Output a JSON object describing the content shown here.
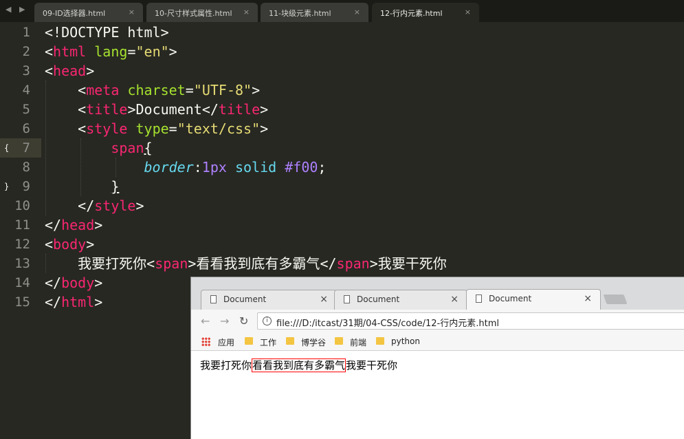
{
  "editor": {
    "tabs": [
      {
        "label": "09-ID选择器.html"
      },
      {
        "label": "10-尺寸样式属性.html"
      },
      {
        "label": "11-块级元素.html"
      },
      {
        "label": "12-行内元素.html"
      }
    ],
    "close_glyph": "×",
    "line_numbers": [
      "1",
      "2",
      "3",
      "4",
      "5",
      "6",
      "7",
      "8",
      "9",
      "10",
      "11",
      "12",
      "13",
      "14",
      "15"
    ],
    "code": {
      "l1": "<!DOCTYPE html>",
      "l2_open": "<",
      "l2_tag": "html",
      "l2_attr": "lang",
      "l2_eq": "=",
      "l2_val": "\"en\"",
      "l2_close": ">",
      "l3_tag": "head",
      "l4_tag": "meta",
      "l4_attr": "charset",
      "l4_val": "\"UTF-8\"",
      "l5_tag": "title",
      "l5_text": "Document",
      "l6_tag": "style",
      "l6_attr": "type",
      "l6_val": "\"text/css\"",
      "l7_sel": "span",
      "l7_brace": "{",
      "l8_prop": "border",
      "l8_num": "1px",
      "l8_kw": "solid",
      "l8_color": "#f00",
      "l8_semi": ";",
      "l9_brace": "}",
      "l10_tag": "style",
      "l11_tag": "head",
      "l12_tag": "body",
      "l13_before": "我要打死你",
      "l13_tag": "span",
      "l13_inner": "看看我到底有多霸气",
      "l13_after": "我要干死你",
      "l14_tag": "body",
      "l15_tag": "html"
    }
  },
  "browser": {
    "tabs": [
      {
        "label": "Document"
      },
      {
        "label": "Document"
      },
      {
        "label": "Document"
      }
    ],
    "close_glyph": "×",
    "nav": {
      "back": "←",
      "forward": "→",
      "reload": "↻"
    },
    "url": "file:///D:/itcast/31期/04-CSS/code/12-行内元素.html",
    "bookmarks": [
      "应用",
      "工作",
      "博学谷",
      "前端",
      "python"
    ],
    "page_text": {
      "before": "我要打死你",
      "span": "看看我到底有多霸气",
      "after": "我要干死你"
    }
  },
  "colors": {
    "editor_bg": "#272822",
    "tag": "#f92672",
    "attribute": "#a6e22e",
    "string": "#e6db74",
    "property": "#66d9ef",
    "number": "#ae81ff",
    "span_border": "#f00"
  }
}
